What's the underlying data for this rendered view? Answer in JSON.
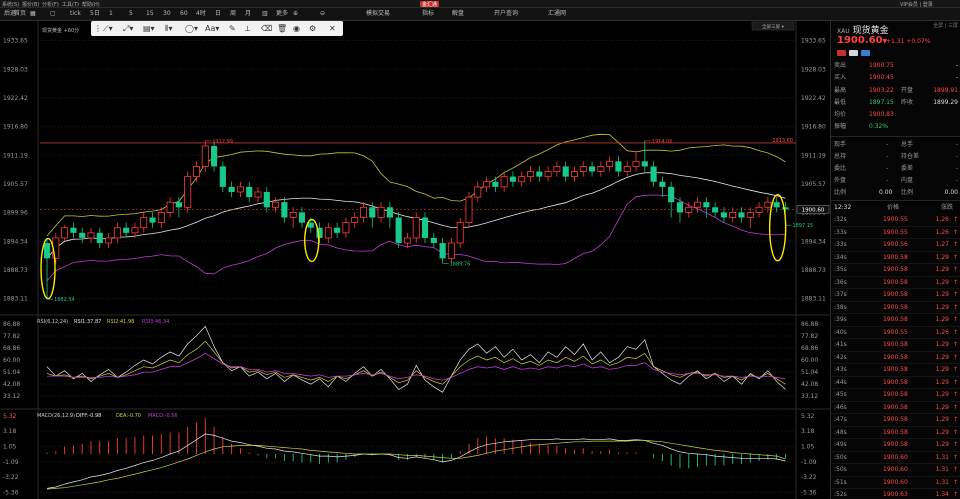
{
  "menubar": {
    "items": [
      "系统(S)",
      "报价(B)",
      "分析(F)",
      "工具(T)",
      "帮助(H)"
    ],
    "brand": "金汇通",
    "right": "VIP会员 | 登录"
  },
  "toolbar": {
    "items": [
      {
        "name": "back",
        "label": "后退"
      },
      {
        "name": "home",
        "label": "首页"
      },
      {
        "name": "grid",
        "label": "▦"
      },
      {
        "name": "square",
        "label": "▢"
      },
      {
        "name": "tick",
        "label": "tick"
      },
      {
        "name": "5d",
        "label": "5日"
      },
      {
        "name": "1m",
        "label": "1"
      },
      {
        "name": "5m",
        "label": "5"
      },
      {
        "name": "15m",
        "label": "15"
      },
      {
        "name": "30m",
        "label": "30"
      },
      {
        "name": "60m",
        "label": "60"
      },
      {
        "name": "4h",
        "label": "4时"
      },
      {
        "name": "day",
        "label": "日"
      },
      {
        "name": "week",
        "label": "周"
      },
      {
        "name": "month",
        "label": "月"
      },
      {
        "name": "period-icon",
        "label": "▥"
      },
      {
        "name": "more",
        "label": "更多"
      },
      {
        "name": "zoom-in",
        "label": "⊕"
      },
      {
        "name": "zoom-out",
        "label": "⊖"
      },
      {
        "name": "sim-trade",
        "label": "模拟交易"
      },
      {
        "name": "indicator",
        "label": "指标"
      },
      {
        "name": "analysis",
        "label": "解盘"
      },
      {
        "name": "open-account",
        "label": "开户查询"
      },
      {
        "name": "huitong",
        "label": "汇通网"
      }
    ]
  },
  "chart": {
    "legend_main": "现货黄金 +60分",
    "right_badge": "全屏三屏 ▾",
    "price_axis": [
      "1933.65",
      "1928.03",
      "1922.42",
      "1916.80",
      "1911.19",
      "1905.57",
      "1899.96",
      "1894.34",
      "1888.73",
      "1883.11"
    ],
    "rsi_legend": {
      "title": "RSI(6,12,24)",
      "rsi1": "RSI1:37.87",
      "rsi2": "RSI2:41.98",
      "rsi3": "RSI3:46.34"
    },
    "rsi_axis": [
      "86.88",
      "77.82",
      "68.86",
      "60.00",
      "51.04",
      "42.08",
      "33.12"
    ],
    "macd_legend": {
      "title": "MACD(26,12,9)",
      "diff": "DIFF:-0.98",
      "dea": "DEA:-0.70",
      "macd": "MACD:-0.56"
    },
    "macd_axis": [
      "5.32",
      "3.18",
      "1.05",
      "-1.09",
      "-3.22",
      "-5.36"
    ],
    "annotations": {
      "high1": "1912.99",
      "high2": "1914.06",
      "low1": "1882.54",
      "low2": "1889.76",
      "low3": "1897.15",
      "resist": "1913.60",
      "current": "1900.60"
    },
    "colors": {
      "up": "#ff3b3b",
      "down": "#19c98b",
      "mid": "#e8e8e8",
      "upper": "#c9c339",
      "lower": "#c23bd4",
      "rsi2": "#d4cf3a",
      "rsi3": "#c23bd4",
      "marker": "#ffeb00"
    }
  },
  "chart_data": {
    "type": "candlestick",
    "title": "现货黄金",
    "ylim": [
      1880.3,
      1936.5
    ],
    "candles": [
      [
        1894,
        1891,
        1895,
        1883
      ],
      [
        1891,
        1895,
        1896,
        1890
      ],
      [
        1895,
        1897,
        1897.5,
        1894.5
      ],
      [
        1897,
        1896,
        1898,
        1895
      ],
      [
        1896,
        1895,
        1897,
        1894
      ],
      [
        1895,
        1896,
        1897,
        1894
      ],
      [
        1896,
        1894,
        1897,
        1893
      ],
      [
        1894,
        1895,
        1896,
        1893
      ],
      [
        1895,
        1897,
        1898,
        1894
      ],
      [
        1897,
        1896,
        1898,
        1895
      ],
      [
        1896,
        1897,
        1898,
        1895
      ],
      [
        1897,
        1899,
        1900,
        1896
      ],
      [
        1899,
        1898,
        1900,
        1897
      ],
      [
        1898,
        1900,
        1901,
        1897
      ],
      [
        1900,
        1902,
        1903,
        1899
      ],
      [
        1902,
        1901,
        1903,
        1899
      ],
      [
        1901,
        1907,
        1908,
        1900
      ],
      [
        1907,
        1909,
        1910,
        1906
      ],
      [
        1909,
        1913,
        1914,
        1908
      ],
      [
        1913,
        1909,
        1914,
        1908
      ],
      [
        1909,
        1905,
        1910,
        1904
      ],
      [
        1905,
        1904,
        1906,
        1903
      ],
      [
        1904,
        1905,
        1906,
        1903
      ],
      [
        1905,
        1903,
        1906,
        1902
      ],
      [
        1903,
        1904,
        1905,
        1902
      ],
      [
        1904,
        1901,
        1905,
        1900
      ],
      [
        1901,
        1902,
        1903,
        1900
      ],
      [
        1902,
        1899,
        1903,
        1898
      ],
      [
        1899,
        1900,
        1901,
        1897
      ],
      [
        1900,
        1898,
        1901,
        1897
      ],
      [
        1898,
        1897,
        1899,
        1896
      ],
      [
        1897,
        1895,
        1898,
        1894
      ],
      [
        1895,
        1897,
        1898,
        1894
      ],
      [
        1897,
        1896,
        1898,
        1895
      ],
      [
        1896,
        1898,
        1899,
        1895
      ],
      [
        1898,
        1899,
        1900,
        1897
      ],
      [
        1899,
        1901,
        1902,
        1898
      ],
      [
        1901,
        1899,
        1902,
        1897
      ],
      [
        1899,
        1901,
        1902,
        1898
      ],
      [
        1901,
        1899,
        1902,
        1897
      ],
      [
        1899,
        1894,
        1900,
        1893
      ],
      [
        1894,
        1895,
        1896,
        1893
      ],
      [
        1895,
        1899,
        1900,
        1894
      ],
      [
        1899,
        1895,
        1900,
        1894
      ],
      [
        1895,
        1894,
        1896,
        1893
      ],
      [
        1894,
        1891,
        1895,
        1890
      ],
      [
        1891,
        1894,
        1895,
        1890
      ],
      [
        1894,
        1898,
        1899,
        1893
      ],
      [
        1898,
        1903,
        1904,
        1897
      ],
      [
        1903,
        1905,
        1906,
        1902
      ],
      [
        1905,
        1906,
        1907,
        1904
      ],
      [
        1906,
        1905,
        1907,
        1904
      ],
      [
        1905,
        1907,
        1908,
        1904
      ],
      [
        1907,
        1906,
        1908,
        1905
      ],
      [
        1906,
        1907,
        1908,
        1905
      ],
      [
        1907,
        1908,
        1909,
        1906
      ],
      [
        1908,
        1907,
        1909,
        1906
      ],
      [
        1907,
        1908,
        1909,
        1906
      ],
      [
        1908,
        1909,
        1910,
        1907
      ],
      [
        1909,
        1907,
        1910,
        1906
      ],
      [
        1907,
        1908,
        1909,
        1906
      ],
      [
        1908,
        1909,
        1910,
        1907
      ],
      [
        1909,
        1908,
        1910,
        1907
      ],
      [
        1908,
        1909,
        1910,
        1907
      ],
      [
        1909,
        1910,
        1911,
        1908
      ],
      [
        1910,
        1908,
        1911,
        1907
      ],
      [
        1908,
        1909,
        1910,
        1907
      ],
      [
        1909,
        1910,
        1912,
        1908
      ],
      [
        1910,
        1909,
        1914,
        1908
      ],
      [
        1909,
        1906,
        1910,
        1905
      ],
      [
        1906,
        1905,
        1907,
        1903
      ],
      [
        1905,
        1902,
        1906,
        1899
      ],
      [
        1902,
        1900,
        1903,
        1898
      ],
      [
        1900,
        1901,
        1902,
        1899
      ],
      [
        1901,
        1902,
        1903,
        1900
      ],
      [
        1902,
        1901,
        1903,
        1899
      ],
      [
        1901,
        1900,
        1902,
        1899
      ],
      [
        1900,
        1899,
        1901,
        1898
      ],
      [
        1899,
        1900,
        1901,
        1898
      ],
      [
        1900,
        1899,
        1901,
        1898
      ],
      [
        1899,
        1900,
        1901,
        1897
      ],
      [
        1900,
        1901,
        1902,
        1899
      ],
      [
        1901,
        1902,
        1903,
        1900
      ],
      [
        1902,
        1901,
        1903,
        1900
      ],
      [
        1901,
        1900.6,
        1902,
        1900
      ]
    ],
    "rsi1": [
      55,
      48,
      52,
      46,
      50,
      44,
      49,
      53,
      47,
      51,
      56,
      60,
      57,
      62,
      66,
      63,
      72,
      78,
      85,
      70,
      58,
      52,
      55,
      48,
      51,
      46,
      50,
      44,
      49,
      45,
      42,
      46,
      40,
      48,
      44,
      50,
      55,
      48,
      53,
      46,
      38,
      42,
      56,
      45,
      40,
      36,
      48,
      60,
      68,
      72,
      65,
      70,
      62,
      68,
      60,
      64,
      58,
      66,
      62,
      70,
      64,
      72,
      60,
      66,
      58,
      62,
      70,
      68,
      75,
      55,
      50,
      45,
      42,
      48,
      52,
      46,
      50,
      44,
      48,
      42,
      50,
      46,
      52,
      44,
      38
    ],
    "rsi2": [
      50,
      48,
      49,
      47,
      48,
      46,
      48,
      50,
      47,
      49,
      52,
      55,
      54,
      57,
      60,
      58,
      64,
      68,
      74,
      66,
      58,
      54,
      55,
      51,
      52,
      49,
      51,
      47,
      49,
      47,
      45,
      47,
      44,
      48,
      46,
      49,
      52,
      48,
      51,
      47,
      43,
      45,
      52,
      47,
      44,
      42,
      48,
      55,
      60,
      63,
      60,
      62,
      58,
      61,
      57,
      59,
      56,
      60,
      58,
      62,
      59,
      63,
      57,
      60,
      56,
      58,
      62,
      61,
      65,
      55,
      52,
      49,
      47,
      50,
      51,
      48,
      50,
      47,
      48,
      45,
      49,
      47,
      50,
      46,
      42
    ],
    "rsi3": [
      48,
      48,
      48,
      47,
      47,
      47,
      47,
      48,
      47,
      48,
      49,
      51,
      51,
      53,
      55,
      55,
      58,
      61,
      65,
      61,
      57,
      55,
      55,
      53,
      53,
      51,
      52,
      50,
      50,
      49,
      48,
      49,
      47,
      48,
      48,
      49,
      50,
      49,
      50,
      48,
      46,
      47,
      49,
      48,
      46,
      45,
      47,
      50,
      53,
      55,
      54,
      55,
      53,
      55,
      53,
      54,
      53,
      55,
      54,
      56,
      55,
      57,
      54,
      55,
      53,
      54,
      56,
      56,
      58,
      53,
      51,
      50,
      49,
      50,
      50,
      49,
      49,
      48,
      48,
      47,
      48,
      47,
      48,
      47,
      46
    ],
    "diff": [
      -4.8,
      -4.6,
      -4.2,
      -3.9,
      -3.6,
      -3.2,
      -3.0,
      -2.7,
      -2.3,
      -2.0,
      -1.6,
      -1.2,
      -0.9,
      -0.5,
      0.0,
      0.4,
      1.2,
      2.0,
      2.8,
      2.6,
      2.2,
      1.8,
      1.6,
      1.3,
      1.1,
      0.8,
      0.7,
      0.4,
      0.3,
      0.1,
      -0.1,
      -0.3,
      -0.3,
      -0.4,
      -0.3,
      -0.2,
      0.0,
      -0.1,
      0.0,
      -0.1,
      -0.5,
      -0.6,
      -0.4,
      -0.6,
      -0.8,
      -1.1,
      -0.9,
      -0.4,
      0.3,
      0.9,
      1.3,
      1.5,
      1.7,
      1.8,
      1.9,
      2.0,
      2.0,
      2.0,
      2.1,
      2.0,
      2.0,
      2.1,
      2.0,
      2.0,
      2.1,
      1.9,
      1.9,
      2.0,
      1.9,
      1.5,
      1.2,
      0.7,
      0.3,
      0.1,
      0.0,
      -0.1,
      -0.3,
      -0.4,
      -0.5,
      -0.6,
      -0.6,
      -0.6,
      -0.6,
      -0.7,
      -0.98
    ],
    "dea": [
      -4.9,
      -4.8,
      -4.7,
      -4.5,
      -4.3,
      -4.1,
      -3.9,
      -3.6,
      -3.4,
      -3.1,
      -2.8,
      -2.5,
      -2.2,
      -1.9,
      -1.5,
      -1.1,
      -0.7,
      -0.2,
      0.3,
      0.7,
      1.0,
      1.1,
      1.2,
      1.2,
      1.2,
      1.1,
      1.0,
      0.9,
      0.8,
      0.7,
      0.5,
      0.4,
      0.3,
      0.2,
      0.1,
      0.0,
      0.0,
      0.0,
      0.0,
      0.0,
      -0.1,
      -0.2,
      -0.2,
      -0.3,
      -0.4,
      -0.5,
      -0.6,
      -0.6,
      -0.4,
      -0.2,
      0.1,
      0.4,
      0.6,
      0.8,
      1.0,
      1.2,
      1.3,
      1.4,
      1.5,
      1.6,
      1.7,
      1.7,
      1.8,
      1.8,
      1.8,
      1.8,
      1.8,
      1.9,
      1.9,
      1.8,
      1.7,
      1.5,
      1.3,
      1.1,
      0.9,
      0.7,
      0.5,
      0.4,
      0.2,
      0.1,
      0.0,
      -0.1,
      -0.2,
      -0.3,
      -0.7
    ]
  },
  "sidebar": {
    "tab": "全屏 | 三屏",
    "code": "XAU",
    "name": "现货黄金",
    "price": "1900.60",
    "arrow": "▼",
    "change": "+1.31",
    "pct": "+0.07%",
    "quote_rows": [
      {
        "l": "卖出",
        "v": "1900.75",
        "vc": "red",
        "l2": "",
        "v2": "-"
      },
      {
        "l": "买入",
        "v": "1900.45",
        "vc": "red",
        "l2": "",
        "v2": "-"
      },
      {
        "l": "最高",
        "v": "1903.22",
        "vc": "red",
        "l2": "开盘",
        "v2": "1899.91"
      },
      {
        "l": "最低",
        "v": "1897.15",
        "vc": "green",
        "l2": "昨收",
        "v2": "1899.29"
      },
      {
        "l": "均价",
        "v": "1900.83",
        "vc": "red",
        "l2": "",
        "v2": ""
      },
      {
        "l": "振幅",
        "v": "0.32%",
        "vc": "green",
        "l2": "",
        "v2": ""
      }
    ],
    "stat_rows": [
      {
        "l": "现手",
        "v": "-",
        "l2": "总手",
        "v2": "-"
      },
      {
        "l": "总持",
        "v": "-",
        "l2": "持仓差",
        "v2": "-"
      },
      {
        "l": "委比",
        "v": "-",
        "l2": "委差",
        "v2": "-"
      },
      {
        "l": "外盘",
        "v": "-",
        "l2": "内盘",
        "v2": "-"
      },
      {
        "l": "比例",
        "v": "0.00",
        "l2": "比例",
        "v2": "0.00"
      }
    ],
    "tick_header": {
      "time": "12:32",
      "price": "价格",
      "chg": "涨跌"
    },
    "ticks": [
      {
        "t": ":32s",
        "p": "1900.55",
        "c": "1.26"
      },
      {
        "t": ":33s",
        "p": "1900.55",
        "c": "1.26"
      },
      {
        "t": ":33s",
        "p": "1900.56",
        "c": "1.27"
      },
      {
        "t": ":34s",
        "p": "1900.58",
        "c": "1.29"
      },
      {
        "t": ":35s",
        "p": "1900.58",
        "c": "1.29"
      },
      {
        "t": ":36s",
        "p": "1900.58",
        "c": "1.29"
      },
      {
        "t": ":37s",
        "p": "1900.58",
        "c": "1.29"
      },
      {
        "t": ":38s",
        "p": "1900.58",
        "c": "1.29"
      },
      {
        "t": ":39s",
        "p": "1900.58",
        "c": "1.29"
      },
      {
        "t": ":40s",
        "p": "1900.55",
        "c": "1.26"
      },
      {
        "t": ":41s",
        "p": "1900.58",
        "c": "1.29"
      },
      {
        "t": ":42s",
        "p": "1900.58",
        "c": "1.29"
      },
      {
        "t": ":43s",
        "p": "1900.58",
        "c": "1.29"
      },
      {
        "t": ":44s",
        "p": "1900.58",
        "c": "1.29"
      },
      {
        "t": ":45s",
        "p": "1900.58",
        "c": "1.29"
      },
      {
        "t": ":46s",
        "p": "1900.58",
        "c": "1.29"
      },
      {
        "t": ":47s",
        "p": "1900.58",
        "c": "1.29"
      },
      {
        "t": ":48s",
        "p": "1900.58",
        "c": "1.29"
      },
      {
        "t": ":49s",
        "p": "1900.58",
        "c": "1.29"
      },
      {
        "t": ":50s",
        "p": "1900.60",
        "c": "1.31"
      },
      {
        "t": ":50s",
        "p": "1900.60",
        "c": "1.31"
      },
      {
        "t": ":51s",
        "p": "1900.60",
        "c": "1.31"
      },
      {
        "t": ":52s",
        "p": "1900.63",
        "c": "1.34"
      }
    ]
  }
}
